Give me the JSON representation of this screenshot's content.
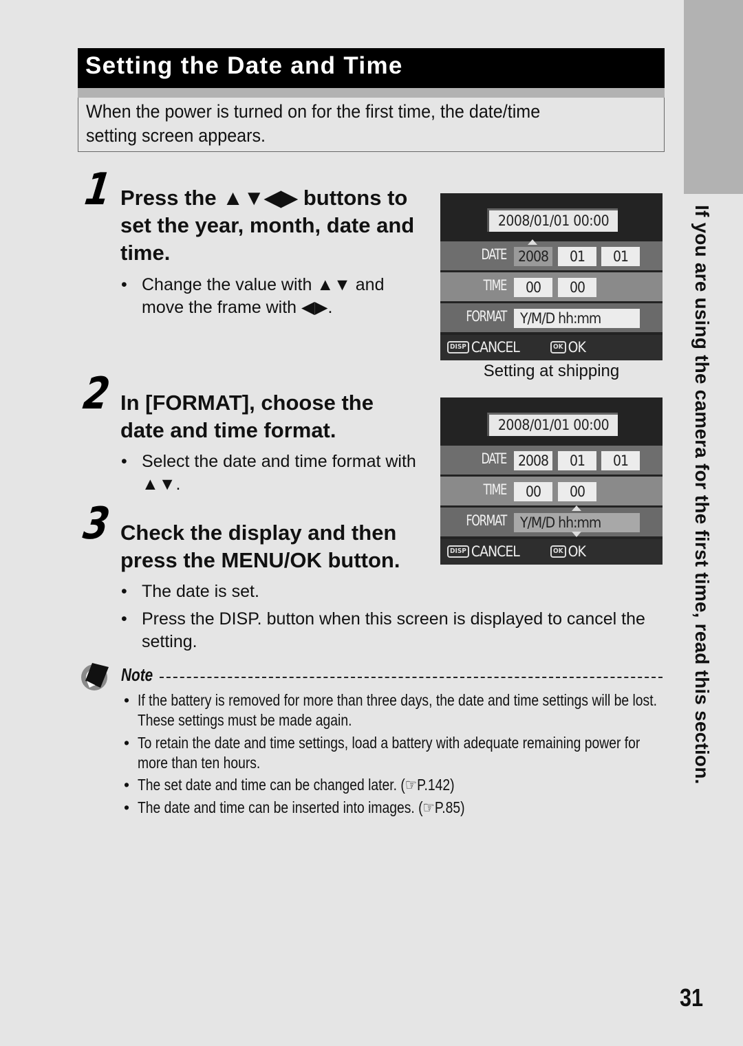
{
  "section_tab": {
    "side_text": "If you are using the camera for the first time, read this section."
  },
  "header": {
    "title": "Setting the Date and Time",
    "intro": "When the power is turned on for the first time, the date/time\nsetting screen appears."
  },
  "steps": [
    {
      "number": "1",
      "title": "Press the ▲▼◀▶ buttons to set the year, month, date and time.",
      "bullets": [
        "Change the value with ▲▼ and move the frame with ◀▶."
      ]
    },
    {
      "number": "2",
      "title": "In [FORMAT], choose the date and time format.",
      "bullets": [
        "Select the date and time format with ▲▼."
      ]
    },
    {
      "number": "3",
      "title": "Check the display and then press the MENU/OK button.",
      "bullets": [
        "The date is set.",
        "Press the DISP. button when this screen is displayed to cancel the setting."
      ]
    }
  ],
  "screens": [
    {
      "datetime_display": "2008/01/01 00:00",
      "date_label": "DATE",
      "date_values": [
        "2008",
        "01",
        "01"
      ],
      "time_label": "TIME",
      "time_values": [
        "00",
        "00"
      ],
      "format_label": "FORMAT",
      "format_value": "Y/M/D hh:mm",
      "selected_field": "year",
      "cancel_key": "DISP",
      "cancel_label": "CANCEL",
      "ok_key": "OK",
      "ok_label": "OK",
      "caption": "Setting at shipping"
    },
    {
      "datetime_display": "2008/01/01 00:00",
      "date_label": "DATE",
      "date_values": [
        "2008",
        "01",
        "01"
      ],
      "time_label": "TIME",
      "time_values": [
        "00",
        "00"
      ],
      "format_label": "FORMAT",
      "format_value": "Y/M/D hh:mm",
      "selected_field": "format",
      "cancel_key": "DISP",
      "cancel_label": "CANCEL",
      "ok_key": "OK",
      "ok_label": "OK"
    }
  ],
  "note": {
    "heading": "Note",
    "icon": "note-pencil-icon",
    "items": [
      "If the battery is removed for more than three days, the date and time settings will be lost. These settings must be made again.",
      "To retain the date and time settings, load a battery with adequate remaining power for more than ten hours.",
      "The set date and time can be changed later. (☞P.142)",
      "The date and time can be inserted into images. (☞P.85)"
    ]
  },
  "page_number": "31"
}
